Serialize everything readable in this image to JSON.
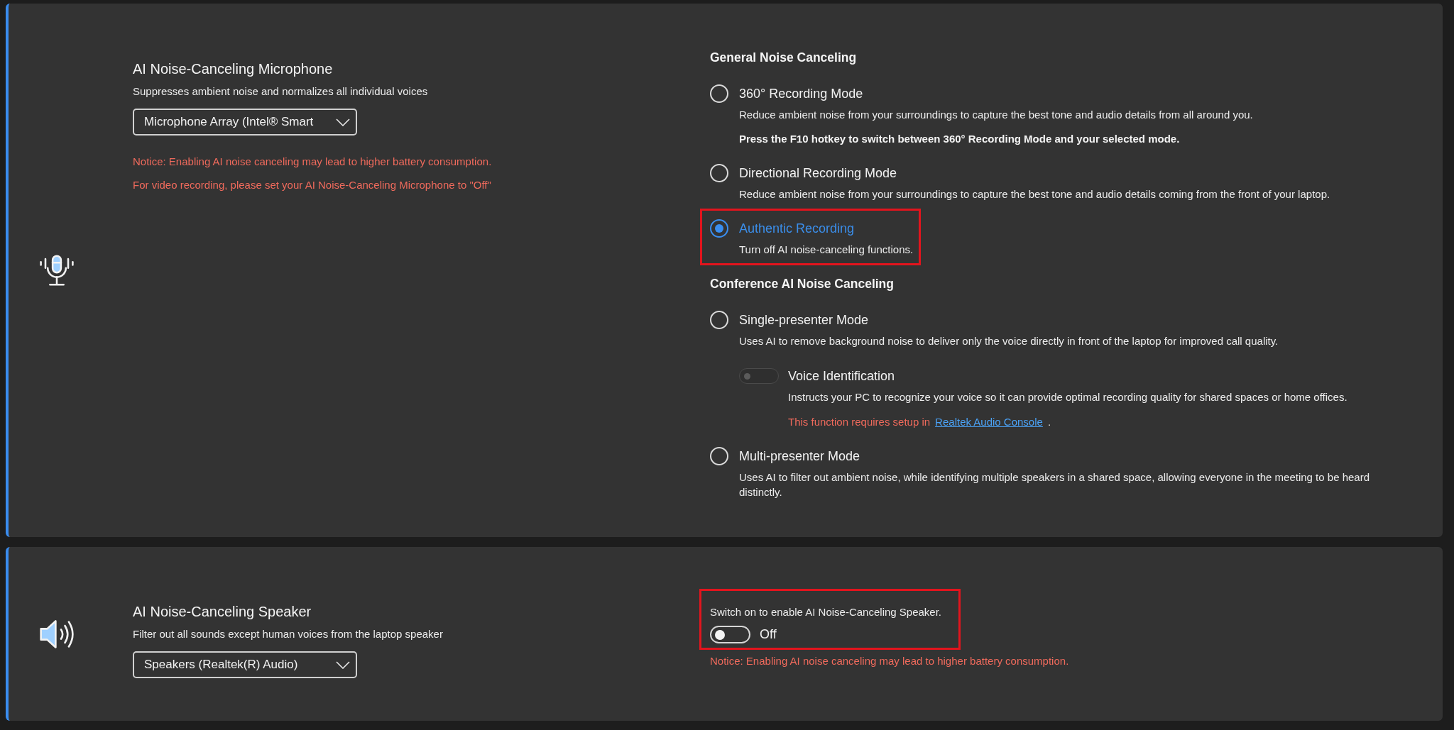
{
  "microphone_panel": {
    "title": "AI Noise-Canceling Microphone",
    "description": "Suppresses ambient noise and normalizes all individual voices",
    "device_dropdown": {
      "value": "Microphone Array (Intel® Smart"
    },
    "notices": [
      "Notice: Enabling AI noise canceling may lead to higher battery consumption.",
      "For video recording, please set your AI Noise-Canceling Microphone to \"Off\""
    ],
    "mode_groups": [
      {
        "heading": "General Noise Canceling",
        "options": [
          {
            "label": "360° Recording Mode",
            "description": "Reduce ambient noise from your surroundings to capture the best tone and audio details from all around you.",
            "note": "Press the F10 hotkey to switch between 360° Recording Mode and your selected mode.",
            "selected": false,
            "highlighted": false
          },
          {
            "label": "Directional Recording Mode",
            "description": "Reduce ambient noise from your surroundings to capture the best tone and audio details coming from the front of your laptop.",
            "selected": false,
            "highlighted": false
          },
          {
            "label": "Authentic Recording",
            "description": "Turn off AI noise-canceling functions.",
            "selected": true,
            "highlighted": true
          }
        ]
      },
      {
        "heading": "Conference AI Noise Canceling",
        "options": [
          {
            "label": "Single-presenter Mode",
            "description": "Uses AI to remove background noise to deliver only the voice directly in front of the laptop for improved call quality.",
            "selected": false,
            "highlighted": false,
            "sub_setting": {
              "label": "Voice Identification",
              "on": false,
              "disabled": true,
              "description": "Instructs your PC to recognize your voice so it can provide optimal recording quality for shared spaces or home offices.",
              "requirement": {
                "text": "This function requires setup in",
                "link": "Realtek Audio Console",
                "suffix": "."
              }
            }
          },
          {
            "label": "Multi-presenter Mode",
            "description": "Uses AI to filter out ambient noise, while identifying multiple speakers in a shared space, allowing everyone in the meeting to be heard distinctly.",
            "selected": false,
            "highlighted": false
          }
        ]
      }
    ]
  },
  "speaker_panel": {
    "title": "AI Noise-Canceling Speaker",
    "description": "Filter out all sounds except human voices from the laptop speaker",
    "device_dropdown": {
      "value": "Speakers (Realtek(R) Audio)"
    },
    "switch": {
      "prompt": "Switch on to enable AI Noise-Canceling Speaker.",
      "on": false,
      "state_label": "Off",
      "highlighted": true
    },
    "notices": [
      "Notice: Enabling AI noise canceling may lead to higher battery consumption."
    ]
  }
}
